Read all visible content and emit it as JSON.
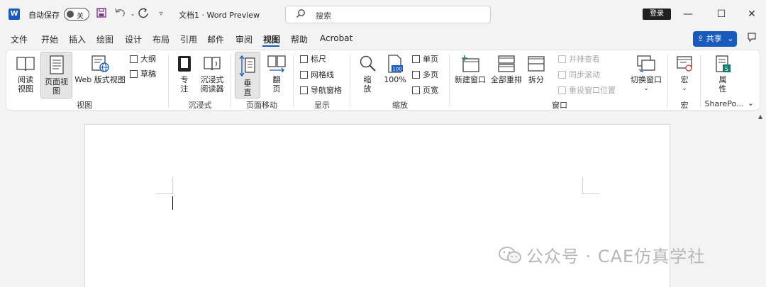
{
  "titlebar": {
    "logo_text": "W",
    "autosave_label": "自动保存",
    "autosave_state": "关",
    "undo_icon": "undo-icon",
    "redo_icon": "redo-icon",
    "customize_icon": "▿",
    "doc_title": "文档1 · Word Preview",
    "search_placeholder": "搜索",
    "login_label": "登录",
    "minimize_glyph": "—",
    "maximize_glyph": "☐",
    "close_glyph": "✕"
  },
  "menu": {
    "items": [
      "文件",
      "开始",
      "插入",
      "绘图",
      "设计",
      "布局",
      "引用",
      "邮件",
      "审阅",
      "视图",
      "帮助",
      "Acrobat"
    ],
    "active": "视图",
    "share_label": "共享",
    "share_chevron": "⌄"
  },
  "ribbon": {
    "views": {
      "read_mode": "阅读视图",
      "print_layout": "页面视图",
      "web_layout": "Web 版式视图",
      "outline": "大纲",
      "draft": "草稿",
      "group": "视图"
    },
    "immersive": {
      "focus": "专注",
      "immersive_reader": "沉浸式阅读器",
      "group": "沉浸式"
    },
    "page_movement": {
      "vertical": "垂直",
      "side_to_side": "翻页",
      "group": "页面移动"
    },
    "show": {
      "ruler": "标尺",
      "gridlines": "网格线",
      "nav_pane": "导航窗格",
      "group": "显示"
    },
    "zoom": {
      "zoom": "缩放",
      "hundred": "100%",
      "hundred_badge": "100",
      "one_page": "单页",
      "multi_page": "多页",
      "page_width": "页宽",
      "group": "缩放"
    },
    "window": {
      "new_window": "新建窗口",
      "arrange_all": "全部重排",
      "split": "拆分",
      "side_by_side": "并排查看",
      "sync_scroll": "同步滚动",
      "reset_position": "重设窗口位置",
      "switch_windows": "切换窗口",
      "group": "窗口"
    },
    "macros": {
      "macros": "宏",
      "group": "宏"
    },
    "sharepoint": {
      "properties": "属性",
      "group": "SharePo..."
    },
    "collapse_glyph": "⌄"
  },
  "workspace": {
    "watermark": "公众号 · CAE仿真学社"
  },
  "colors": {
    "accent": "#185abd",
    "ribbon_bg": "#ffffff",
    "app_bg": "#f3f3f3",
    "page_bg": "#ffffff"
  }
}
